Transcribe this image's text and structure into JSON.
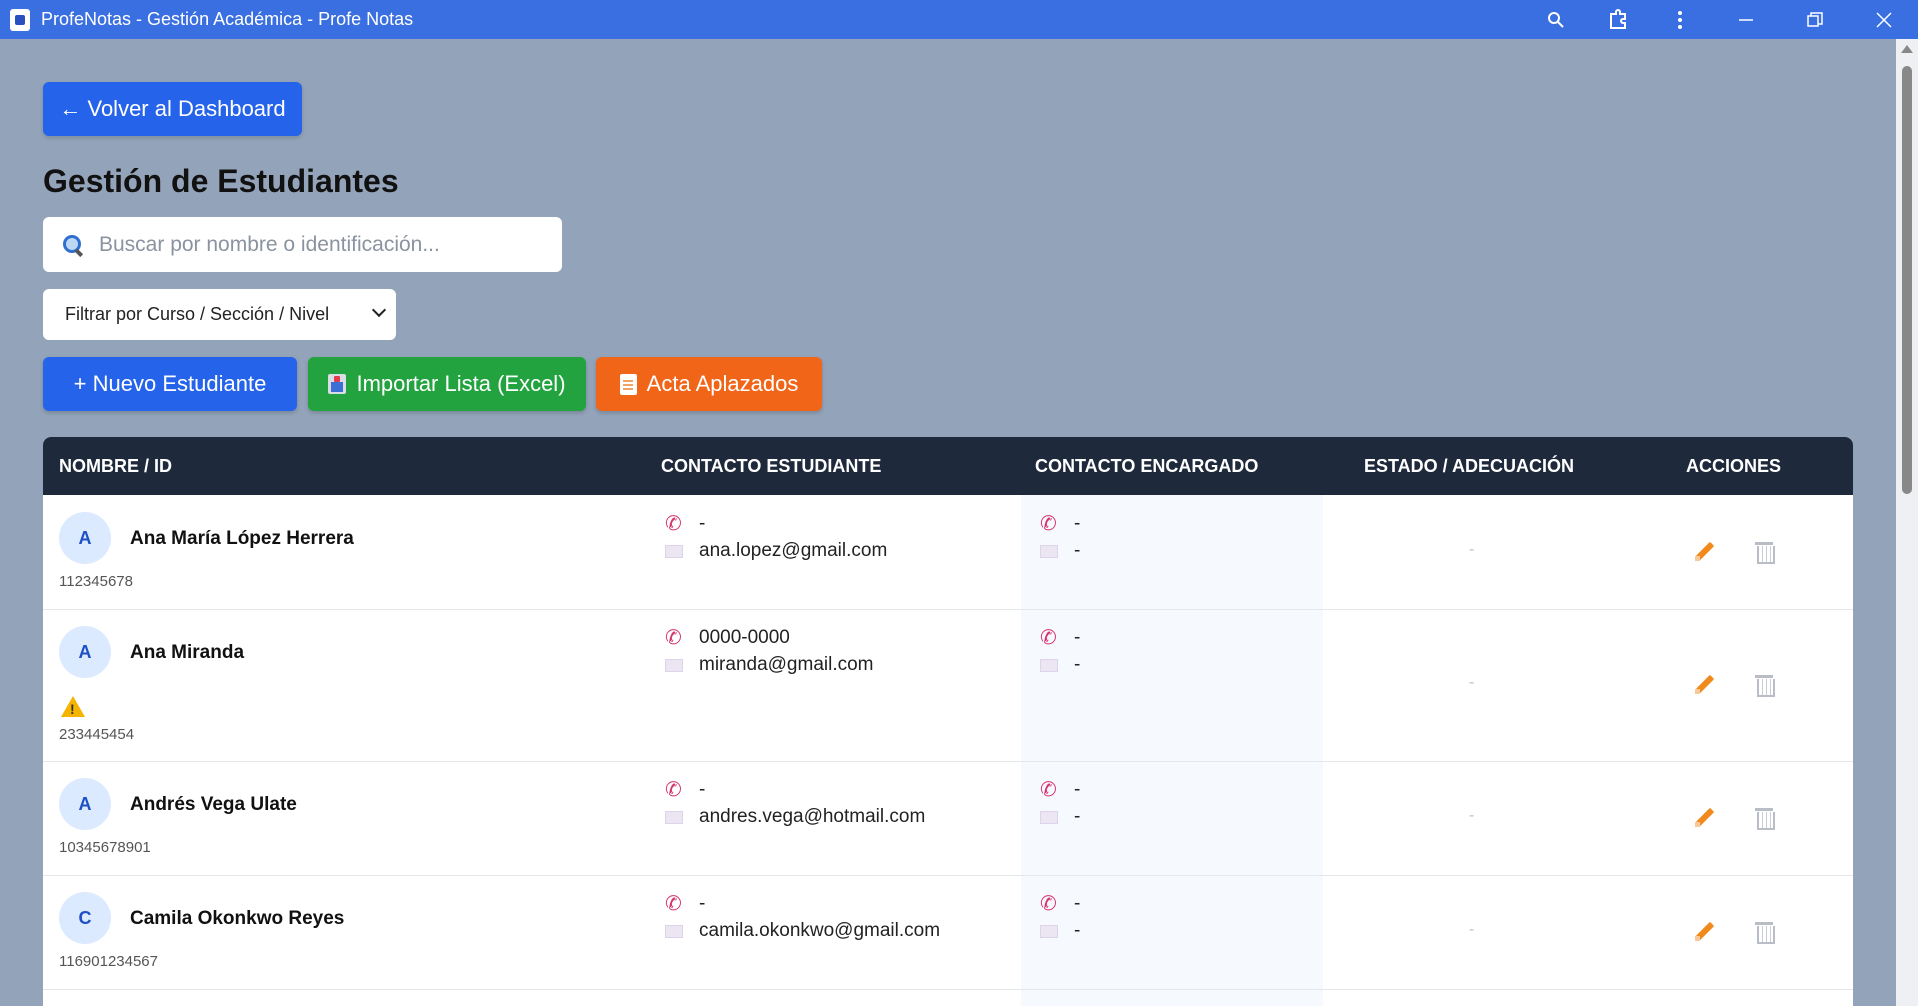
{
  "window": {
    "title": "ProfeNotas - Gestión Académica - Profe Notas",
    "controls": [
      "zoom-icon",
      "extensions-icon",
      "menu-icon",
      "minimize-icon",
      "restore-icon",
      "close-icon"
    ]
  },
  "back_button": "← Volver al Dashboard",
  "page_title": "Gestión de Estudiantes",
  "search": {
    "placeholder": "Buscar por nombre o identificación...",
    "value": ""
  },
  "filter": {
    "selected": "Filtrar por Curso / Sección / Nivel"
  },
  "actions": {
    "new_student": "+ Nuevo Estudiante",
    "import": "Importar Lista (Excel)",
    "acta": "Acta Aplazados"
  },
  "table": {
    "headers": [
      "NOMBRE / ID",
      "CONTACTO ESTUDIANTE",
      "CONTACTO ENCARGADO",
      "ESTADO / ADECUACIÓN",
      "ACCIONES"
    ],
    "rows": [
      {
        "initial": "A",
        "name": "Ana María López Herrera",
        "id": "112345678",
        "warning": false,
        "phone": "-",
        "email": "ana.lopez@gmail.com",
        "guardian_phone": "-",
        "guardian_email": "-",
        "estado": "-"
      },
      {
        "initial": "A",
        "name": "Ana Miranda",
        "id": "233445454",
        "warning": true,
        "phone": "0000-0000",
        "email": "miranda@gmail.com",
        "guardian_phone": "-",
        "guardian_email": "-",
        "estado": "-"
      },
      {
        "initial": "A",
        "name": "Andrés Vega Ulate",
        "id": "10345678901",
        "warning": false,
        "phone": "-",
        "email": "andres.vega@hotmail.com",
        "guardian_phone": "-",
        "guardian_email": "-",
        "estado": "-"
      },
      {
        "initial": "C",
        "name": "Camila Okonkwo Reyes",
        "id": "116901234567",
        "warning": false,
        "phone": "-",
        "email": "camila.okonkwo@gmail.com",
        "guardian_phone": "-",
        "guardian_email": "-",
        "estado": "-"
      }
    ]
  },
  "colors": {
    "titlebar": "#3a6fe1",
    "page_bg": "#93a3b9",
    "primary": "#2563eb",
    "success": "#22a33f",
    "warning": "#f06517",
    "table_header": "#1e293b"
  }
}
